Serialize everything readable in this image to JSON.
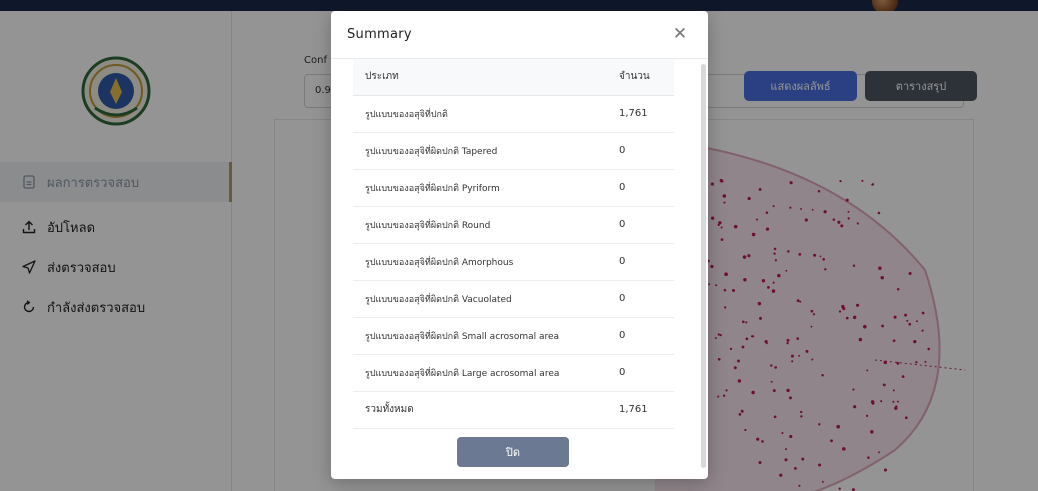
{
  "sidebar": {
    "items": [
      {
        "label": "ผลการตรวจสอบ",
        "icon": "document-icon",
        "active": true
      },
      {
        "label": "อัปโหลด",
        "icon": "upload-icon",
        "active": false
      },
      {
        "label": "ส่งตรวจสอบ",
        "icon": "send-icon",
        "active": false
      },
      {
        "label": "กำลังส่งตรวจสอบ",
        "icon": "refresh-icon",
        "active": false
      }
    ]
  },
  "main": {
    "confidence_label": "Conf",
    "confidence_value": "0.9",
    "show_result_button": "แสดงผลลัพธ์",
    "summary_table_button": "ตารางสรุป"
  },
  "modal": {
    "title": "Summary",
    "close_icon": "close-icon",
    "columns": [
      "ประเภท",
      "จำนวน"
    ],
    "rows": [
      {
        "type": "รูปแบบของอสุจิที่ปกติ",
        "count": "1,761"
      },
      {
        "type": "รูปแบบของอสุจิที่ผิดปกติ Tapered",
        "count": "0"
      },
      {
        "type": "รูปแบบของอสุจิที่ผิดปกติ Pyriform",
        "count": "0"
      },
      {
        "type": "รูปแบบของอสุจิที่ผิดปกติ Round",
        "count": "0"
      },
      {
        "type": "รูปแบบของอสุจิที่ผิดปกติ Amorphous",
        "count": "0"
      },
      {
        "type": "รูปแบบของอสุจิที่ผิดปกติ Vacuolated",
        "count": "0"
      },
      {
        "type": "รูปแบบของอสุจิที่ผิดปกติ Small acrosomal area",
        "count": "0"
      },
      {
        "type": "รูปแบบของอสุจิที่ผิดปกติ Large acrosomal area",
        "count": "0"
      }
    ],
    "total": {
      "type": "รวมทั้งหมด",
      "count": "1,761"
    },
    "close_button": "ปิด"
  },
  "colors": {
    "topbar": "#1b2a4a",
    "primary_button": "#4b6ee0",
    "secondary_button": "#4f5663",
    "close_button": "#6b7a92",
    "active_nav_accent": "#b69a6a",
    "sample_stain": "#c2185b"
  }
}
